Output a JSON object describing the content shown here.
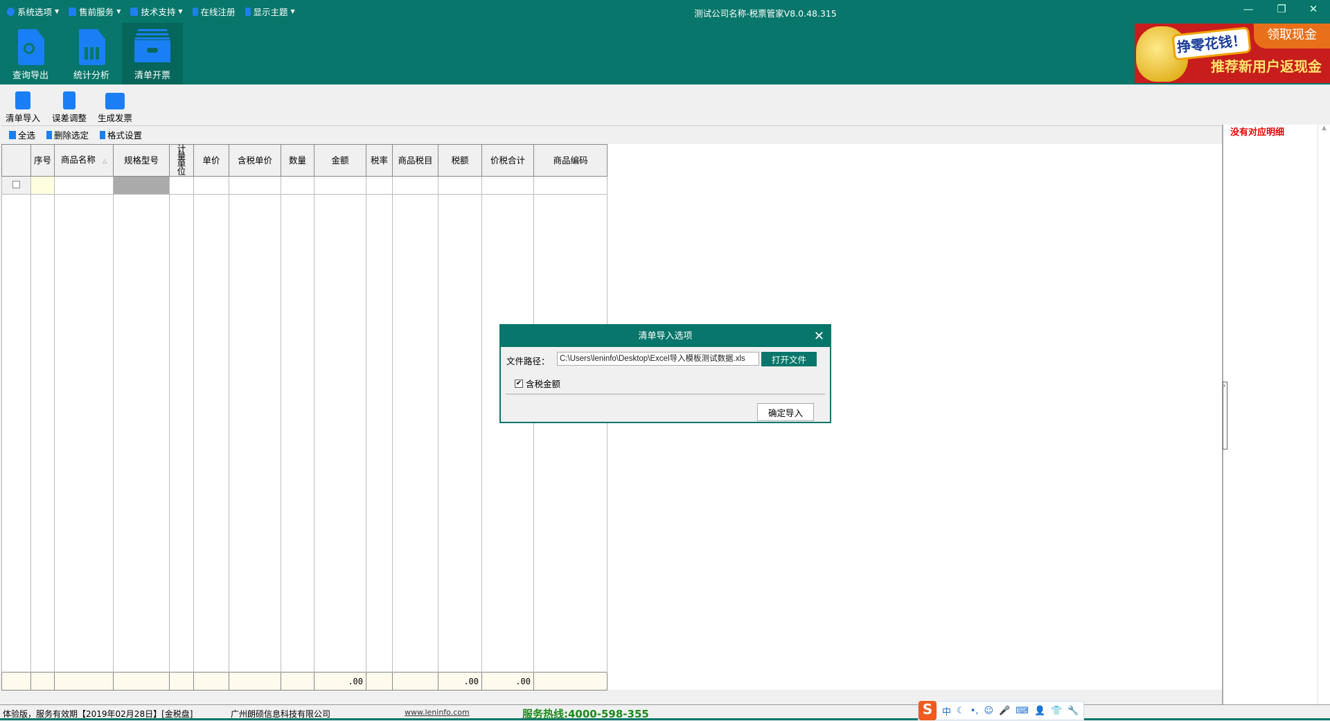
{
  "menu": [
    {
      "label": "系统选项",
      "icon": "info-icon"
    },
    {
      "label": "售前服务",
      "icon": "mail-icon"
    },
    {
      "label": "技术支持",
      "icon": "mail-icon"
    },
    {
      "label": "在线注册",
      "icon": "download-icon"
    },
    {
      "label": "显示主题",
      "icon": "upload-icon"
    }
  ],
  "window": {
    "title": "测试公司名称-税票管家V8.0.48.315",
    "minimize": "—",
    "restore": "❐",
    "close": "✕"
  },
  "main_tabs": [
    {
      "label": "查询导出"
    },
    {
      "label": "统计分析"
    },
    {
      "label": "清单开票"
    }
  ],
  "ad": {
    "bubble": "挣零花钱！",
    "tab": "领取现金",
    "slogan": "推荐新用户返现金"
  },
  "toolbar": [
    {
      "label": "清单导入"
    },
    {
      "label": "误差调整"
    },
    {
      "label": "生成发票"
    }
  ],
  "actions": [
    {
      "label": "全选"
    },
    {
      "label": "删除选定"
    },
    {
      "label": "格式设置"
    }
  ],
  "table": {
    "columns": [
      "",
      "序号",
      "商品名称",
      "规格型号",
      "计量单位",
      "单价",
      "含税单价",
      "数量",
      "金额",
      "税率",
      "商品税目",
      "税额",
      "价税合计",
      "商品编码"
    ],
    "sort_indicator": "△",
    "footer": [
      "",
      "",
      "",
      "",
      "",
      "",
      "",
      "",
      ".00",
      "",
      "",
      ".00",
      ".00",
      ""
    ]
  },
  "right_panel": {
    "message": "没有对应明细"
  },
  "dialog": {
    "title": "清单导入选项",
    "path_label": "文件路径：",
    "path_value": "C:\\Users\\leninfo\\Desktop\\Excel导入模板测试数据.xls",
    "open_button": "打开文件",
    "checkbox_label": "含税金额",
    "checkbox_checked": true,
    "ok_button": "确定导入",
    "close": "✕"
  },
  "status": {
    "edition": "体验版，服务有效期【2019年02月28日】[金税盘]",
    "company": "广州朗硕信息科技有限公司",
    "website": "www.leninfo.com",
    "hotline": "服务热线:4000-598-355"
  },
  "ime": {
    "logo": "S",
    "mode": "中",
    "items": [
      "☾",
      "•,",
      "☺",
      "🎤",
      "⌨",
      "👤",
      "👕",
      "🔧"
    ]
  }
}
